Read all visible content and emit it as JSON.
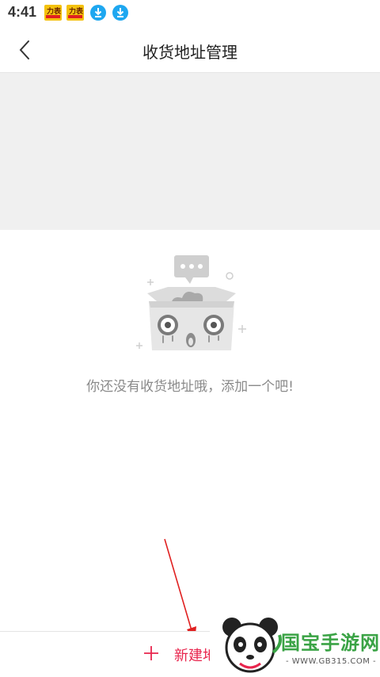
{
  "status_bar": {
    "time": "4:41",
    "icons": [
      "news-app-icon",
      "news-app-icon",
      "download-icon",
      "download-icon"
    ],
    "badge_text": "力表"
  },
  "nav": {
    "back_icon": "chevron-left-icon",
    "title": "收货地址管理"
  },
  "empty_state": {
    "illustration": "empty-box-icon",
    "message": "你还没有收货地址哦，添加一个吧!"
  },
  "bottom": {
    "new_address_label": "新建地",
    "plus_icon": "plus-icon"
  },
  "watermark": {
    "text": "国宝手游网",
    "url": "- WWW.GB315.COM -"
  },
  "colors": {
    "accent": "#e8254d",
    "banner_bg": "#f0f0f0",
    "muted_text": "#8a8a8a",
    "watermark_green": "#3aa345"
  }
}
